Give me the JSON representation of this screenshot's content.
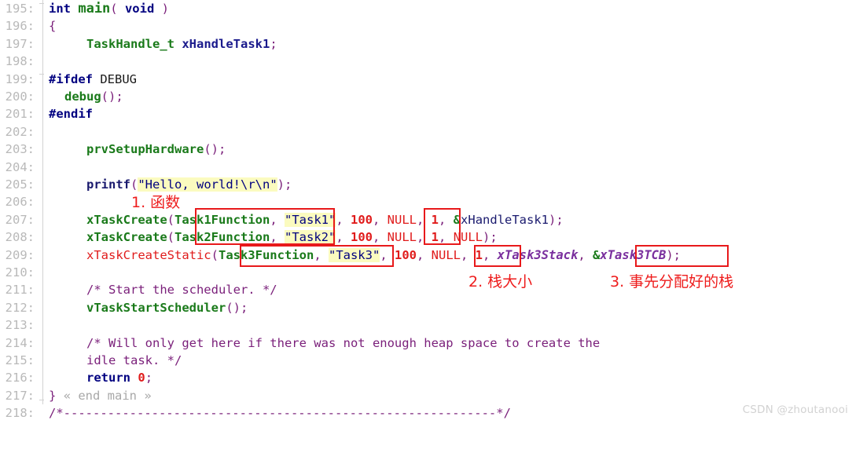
{
  "editor": {
    "language": "C",
    "first_line_number": 195,
    "last_line_number": 218,
    "fold_marker_text": "« end main »",
    "lines": [
      {
        "num": "195:",
        "text": "int main( void )"
      },
      {
        "num": "196:",
        "text": "{"
      },
      {
        "num": "197:",
        "text": "    TaskHandle_t xHandleTask1;"
      },
      {
        "num": "198:",
        "text": ""
      },
      {
        "num": "199:",
        "text": "#ifdef DEBUG"
      },
      {
        "num": "200:",
        "text": "  debug();"
      },
      {
        "num": "201:",
        "text": "#endif"
      },
      {
        "num": "202:",
        "text": ""
      },
      {
        "num": "203:",
        "text": "    prvSetupHardware();"
      },
      {
        "num": "204:",
        "text": ""
      },
      {
        "num": "205:",
        "text": "    printf(\"Hello, world!\\r\\n\");"
      },
      {
        "num": "206:",
        "text": ""
      },
      {
        "num": "207:",
        "text": "    xTaskCreate(Task1Function, \"Task1\", 100, NULL, 1, &xHandleTask1);"
      },
      {
        "num": "208:",
        "text": "    xTaskCreate(Task2Function, \"Task2\", 100, NULL, 1, NULL);"
      },
      {
        "num": "209:",
        "text": "    xTaskCreateStatic(Task3Function, \"Task3\", 100, NULL, 1, xTask3Stack, &xTask3TCB);"
      },
      {
        "num": "210:",
        "text": ""
      },
      {
        "num": "211:",
        "text": "    /* Start the scheduler. */"
      },
      {
        "num": "212:",
        "text": "    vTaskStartScheduler();"
      },
      {
        "num": "213:",
        "text": ""
      },
      {
        "num": "214:",
        "text": "    /* Will only get here if there was not enough heap space to create the"
      },
      {
        "num": "215:",
        "text": "    idle task. */"
      },
      {
        "num": "216:",
        "text": "    return 0;"
      },
      {
        "num": "217:",
        "text": "} « end main »"
      },
      {
        "num": "218:",
        "text": "/*-----------------------------------------------------------*/"
      }
    ]
  },
  "annotations": {
    "color": "#ee1c1c",
    "labels": [
      {
        "id": "label-1",
        "text": "1. 函数"
      },
      {
        "id": "label-2",
        "text": "2. 栈大小"
      },
      {
        "id": "label-3",
        "text": "3. 事先分配好的栈"
      }
    ],
    "boxes": [
      {
        "id": "box-functions-12",
        "target": "Task1Function/Task2Function arguments"
      },
      {
        "id": "box-function-3",
        "target": "Task3Function argument"
      },
      {
        "id": "box-stacksize-12",
        "target": "100 stack size on lines 207-208"
      },
      {
        "id": "box-stacksize-3",
        "target": "100 stack size on line 209"
      },
      {
        "id": "box-static-stack",
        "target": "xTask3Stack argument"
      }
    ]
  },
  "watermark": {
    "text": "CSDN @zhoutanooi"
  },
  "code_tokens": {
    "l195": {
      "a": "int",
      "b": "main",
      "c": "( ",
      "d": "void",
      "e": " )"
    },
    "l196": {
      "a": "{"
    },
    "l197": {
      "a": "TaskHandle_t",
      "b": "xHandleTask1",
      "c": ";"
    },
    "l199": {
      "a": "#ifdef",
      "b": "DEBUG"
    },
    "l200": {
      "a": "debug",
      "b": "();"
    },
    "l201": {
      "a": "#endif"
    },
    "l203": {
      "a": "prvSetupHardware",
      "b": "();"
    },
    "l205": {
      "a": "printf",
      "b": "(",
      "c": "\"Hello, world!\\r\\n\"",
      "d": ");"
    },
    "l207": {
      "fn": "xTaskCreate",
      "arg1": "Task1Function",
      "arg2": "\"Task1\"",
      "arg3": "100",
      "arg4": "NULL",
      "arg5": "1",
      "arg6": "xHandleTask1"
    },
    "l208": {
      "fn": "xTaskCreate",
      "arg1": "Task2Function",
      "arg2": "\"Task2\"",
      "arg3": "100",
      "arg4": "NULL",
      "arg5": "1",
      "arg6": "NULL"
    },
    "l209": {
      "fn": "xTaskCreateStatic",
      "arg1": "Task3Function",
      "arg2": "\"Task3\"",
      "arg3": "100",
      "arg4": "NULL",
      "arg5": "1",
      "arg6": "xTask3Stack",
      "arg7": "xTask3TCB"
    },
    "l211": {
      "a": "/* Start the scheduler. */"
    },
    "l212": {
      "a": "vTaskStartScheduler",
      "b": "();"
    },
    "l214": {
      "a": "/* Will only get here if there was not enough heap space to create the"
    },
    "l215": {
      "a": "idle task. */"
    },
    "l216": {
      "a": "return",
      "b": "0",
      "c": ";"
    },
    "l217": {
      "a": "}",
      "b": "« end main »"
    },
    "l218": {
      "a": "/*-----------------------------------------------------------*/"
    }
  }
}
